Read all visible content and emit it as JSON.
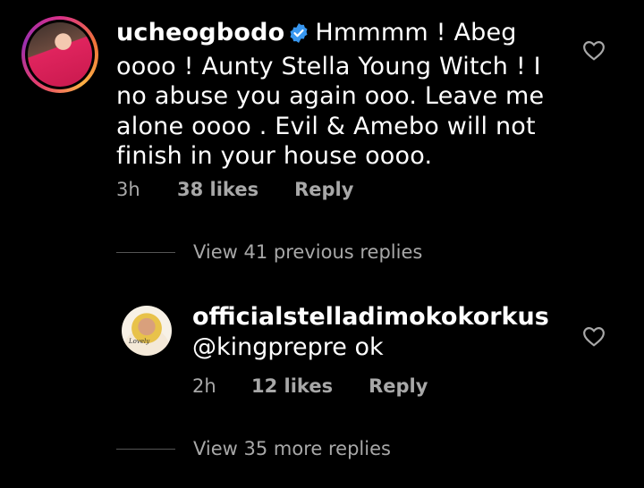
{
  "comment": {
    "username": "ucheogbodo",
    "text": "Hmmmm ! Abeg oooo ! Aunty Stella Young Witch ! I no abuse you again ooo. Leave me alone oooo . Evil & Amebo will not finish in your house oooo.",
    "time": "3h",
    "likes": "38 likes",
    "reply_label": "Reply"
  },
  "view_previous": "View 41 previous replies",
  "reply": {
    "username": "officialstelladimokokorkus",
    "text": "@kingprepre ok",
    "avatar_label": "Lovely",
    "time": "2h",
    "likes": "12 likes",
    "reply_label": "Reply"
  },
  "view_more": "View 35 more replies",
  "colors": {
    "background": "#000000",
    "text": "#ffffff",
    "muted": "#a8a8a8",
    "verified": "#3897f0"
  },
  "icons": {
    "verified": "verified-badge-icon",
    "like": "heart-outline-icon"
  }
}
